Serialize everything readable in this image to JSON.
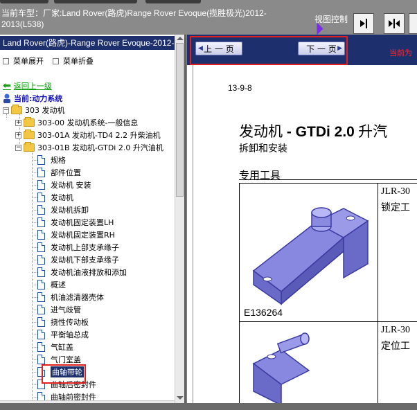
{
  "vehicle_label": "当前车型：厂家:Land Rover(路虎)Range Rover Evoque(揽胜极光)2012-2013(L538)",
  "view_control": "视图控制",
  "sidebar": {
    "header": "Land Rover(路虎)-Range Rover Evoque-2012-2",
    "expand_all": "菜单展开",
    "collapse_all": "菜单折叠",
    "back": "返回上一级",
    "current": "当前:动力系统"
  },
  "tree": {
    "root": "303 发动机",
    "folders": [
      {
        "label": "303-00 发动机系统-一般信息"
      },
      {
        "label": "303-01A 发动机-TD4 2.2 升柴油机"
      },
      {
        "label": "303-01B 发动机-GTDi 2.0 升汽油机"
      }
    ],
    "docs": [
      "规格",
      "部件位置",
      "发动机 安装",
      "发动机",
      "发动机拆卸",
      "发动机固定装置LH",
      "发动机固定装置RH",
      "发动机上部支承缘子",
      "发动机下部支承缘子",
      "发动机油液排放和添加",
      "概述",
      "机油滤清器壳体",
      "进气歧管",
      "挠性传动板",
      "平衡轴总成",
      "气缸盖",
      "气门室盖",
      "曲轴带轮",
      "曲轴后密封件",
      "曲轴前密封件"
    ],
    "selected_index": 17
  },
  "nav": {
    "prev": "上 一 页",
    "next": "下 一 页",
    "current_for": "当前为"
  },
  "doc": {
    "date": "13-9-8",
    "title_cn": "发动机",
    "title_dash": " - ",
    "title_bold": "GTDi 2.0",
    "title_tail": " 升汽",
    "subtitle": "拆卸和安装",
    "tools_heading": "专用工具",
    "tools": [
      {
        "code": "E136264",
        "part": "JLR-30",
        "desc": "锁定工"
      },
      {
        "code": "",
        "part": "JLR-30",
        "desc": "定位工"
      }
    ]
  }
}
